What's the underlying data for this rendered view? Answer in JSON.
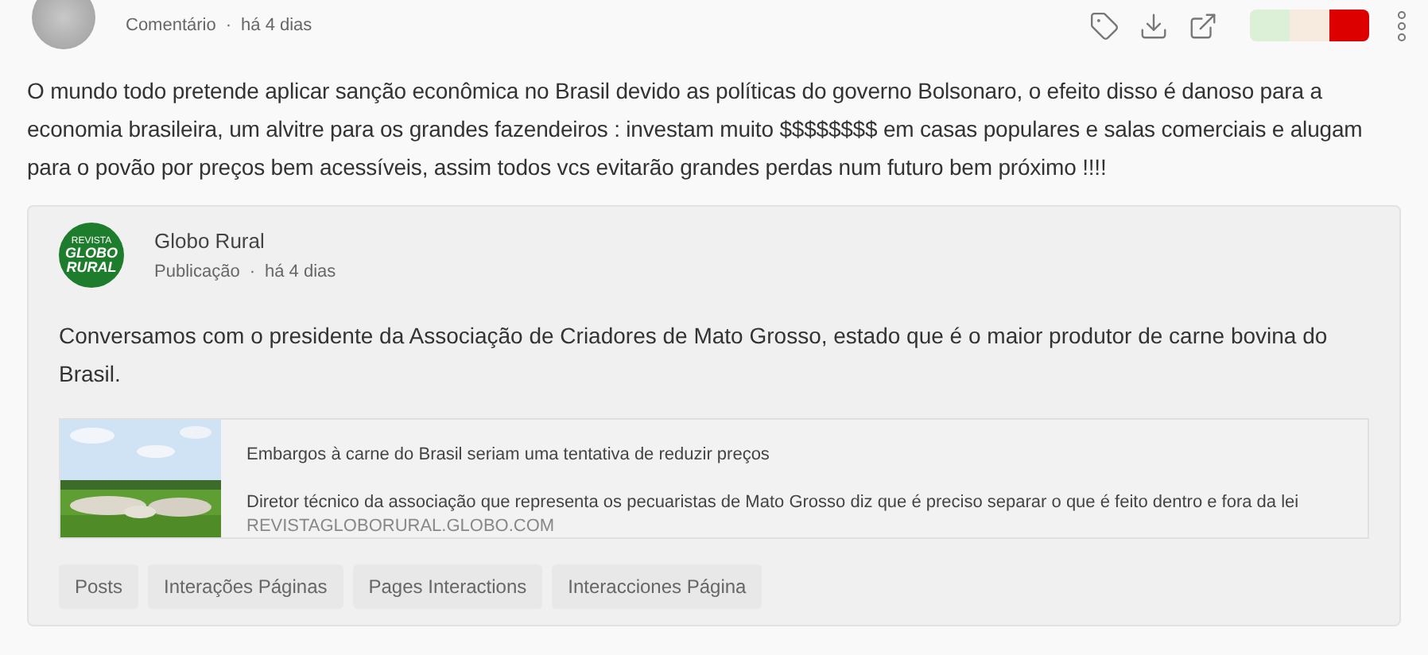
{
  "comment": {
    "type": "Comentário",
    "separator": "·",
    "time": "há 4 dias",
    "text": "O mundo todo pretende aplicar sanção econômica no Brasil devido as políticas do governo Bolsonaro, o efeito disso é danoso para a economia brasileira, um alvitre para os grandes fazendeiros : investam muito $$$$$$$$ em casas populares e salas comerciais e alugam para o povão por preços bem acessíveis, assim todos vcs evitarão grandes perdas num futuro bem próximo !!!!"
  },
  "sentiment": [
    {
      "color": "#dcf0d8"
    },
    {
      "color": "#f7eadf"
    },
    {
      "color": "#dd0000"
    }
  ],
  "post": {
    "author": "Globo Rural",
    "logo": {
      "top": "REVISTA",
      "line1": "GLOBO",
      "line2": "RURAL"
    },
    "type": "Publicação",
    "separator": "·",
    "time": "há 4 dias",
    "text": "Conversamos com o presidente da Associação de Criadores de Mato Grosso, estado que é o maior produtor de carne bovina do Brasil.",
    "link": {
      "title": "Embargos à carne do Brasil seriam uma tentativa de reduzir preços",
      "description": "Diretor técnico da associação que representa os pecuaristas de Mato Grosso diz que é preciso separar o que é feito dentro e fora da lei",
      "domain": "REVISTAGLOBORURAL.GLOBO.COM"
    }
  },
  "tags": [
    "Posts",
    "Interações Páginas",
    "Pages Interactions",
    "Interacciones Página"
  ]
}
